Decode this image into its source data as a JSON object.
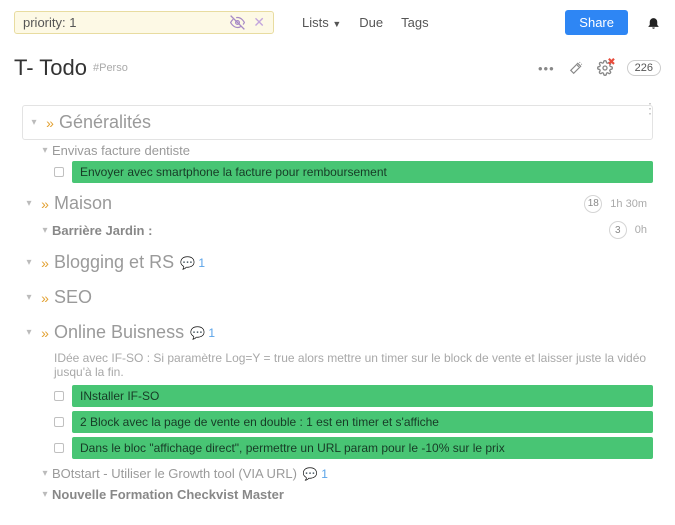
{
  "search": {
    "value": "priority: 1"
  },
  "top_nav": {
    "lists_label": "Lists",
    "due_label": "Due",
    "tags_label": "Tags"
  },
  "share_label": "Share",
  "page": {
    "title": "T- Todo",
    "tag": "#Perso",
    "count": "226"
  },
  "sec1": {
    "title": "Généralités",
    "child": "Envivas facture dentiste",
    "task1": "Envoyer avec smartphone la facture pour remboursement"
  },
  "sec2": {
    "title": "Maison",
    "badge": "18",
    "time": "1h 30m",
    "child": "Barrière Jardin :",
    "child_badge": "3",
    "child_time": "0h"
  },
  "sec3": {
    "title": "Blogging et RS",
    "comments": "1"
  },
  "sec4": {
    "title": "SEO"
  },
  "sec5": {
    "title": "Online Buisness",
    "comments": "1",
    "desc": "IDée avec IF-SO : Si paramètre Log=Y = true alors mettre un timer sur le block de vente et laisser juste la vidéo jusqu'à la fin.",
    "task1": "INstaller IF-SO",
    "task2": "2 Block avec la page de vente en double : 1 est en timer et s'affiche",
    "task3": "Dans le bloc \"affichage direct\", permettre un URL param pour le -10% sur le prix",
    "child2": "BOtstart - Utiliser le Growth tool (VIA URL)",
    "child2_comments": "1",
    "child3": "Nouvelle Formation Checkvist Master"
  }
}
